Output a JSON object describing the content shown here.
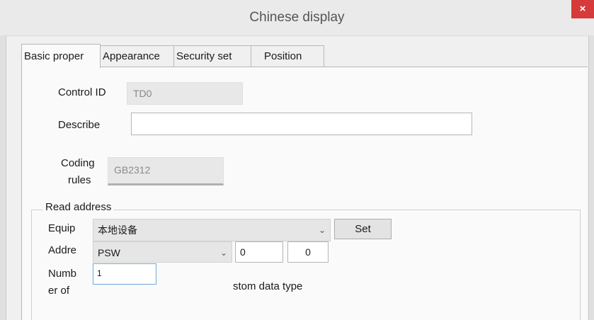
{
  "window": {
    "title": "Chinese display",
    "close_glyph": "×"
  },
  "tabs": [
    {
      "label": "Basic proper",
      "active": true
    },
    {
      "label": "Appearance",
      "active": false
    },
    {
      "label": "Security set",
      "active": false
    },
    {
      "label": "Position",
      "active": false
    }
  ],
  "basic": {
    "control_id_label": "Control ID",
    "control_id_value": "TD0",
    "describe_label": "Describe",
    "describe_value": "",
    "coding_label_1": "Coding",
    "coding_label_2": "rules",
    "coding_value": "GB2312"
  },
  "read_address": {
    "group_title": "Read address",
    "equip_label": "Equip",
    "equip_value": "本地设备",
    "set_button": "Set",
    "addr_label": "Addre",
    "addr_type_value": "PSW",
    "addr_num_1": "0",
    "addr_num_2": "0",
    "number_label_1": "Numb",
    "number_label_2": "er of",
    "number_value": "1",
    "custom_data_type": "stom data type"
  },
  "icons": {
    "close": "close-icon",
    "dropdown": "chevron-down-icon"
  },
  "colors": {
    "close_bg": "#d63a3a",
    "focus_border": "#6fa9dc"
  }
}
